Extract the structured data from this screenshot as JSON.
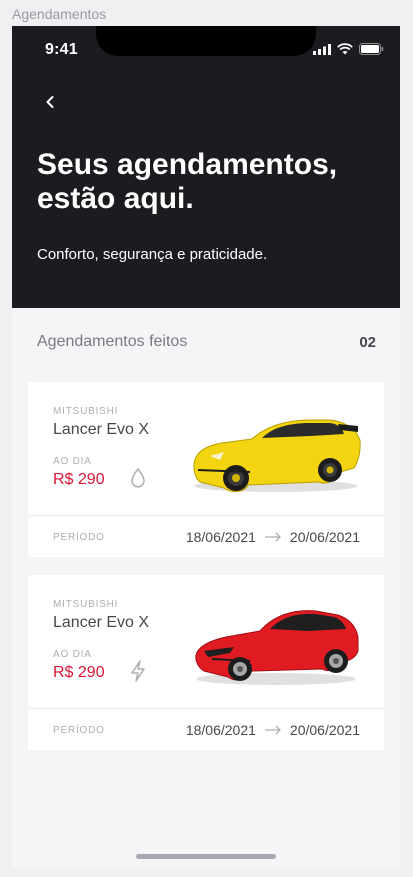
{
  "frame_label": "Agendamentos",
  "status_bar": {
    "time": "9:41"
  },
  "header": {
    "title": "Seus agendamentos, estão aqui.",
    "subtitle": "Conforto, segurança e praticidade."
  },
  "section": {
    "title": "Agendamentos feitos",
    "count": "02"
  },
  "bookings": [
    {
      "brand": "MITSUBISHI",
      "model": "Lancer Evo X",
      "rent_label": "AO DIA",
      "price": "R$ 290",
      "fuel_icon": "gasoline-drop-icon",
      "car_color": "#F2D410",
      "period_label": "PERÍODO",
      "start_date": "18/06/2021",
      "end_date": "20/06/2021"
    },
    {
      "brand": "MITSUBISHI",
      "model": "Lancer Evo X",
      "rent_label": "AO DIA",
      "price": "R$ 290",
      "fuel_icon": "electric-bolt-icon",
      "car_color": "#E11B22",
      "period_label": "PERÍODO",
      "start_date": "18/06/2021",
      "end_date": "20/06/2021"
    }
  ],
  "colors": {
    "header_bg": "#1C1C20",
    "accent_red": "#DC1637",
    "page_bg": "#F4F5F6"
  }
}
